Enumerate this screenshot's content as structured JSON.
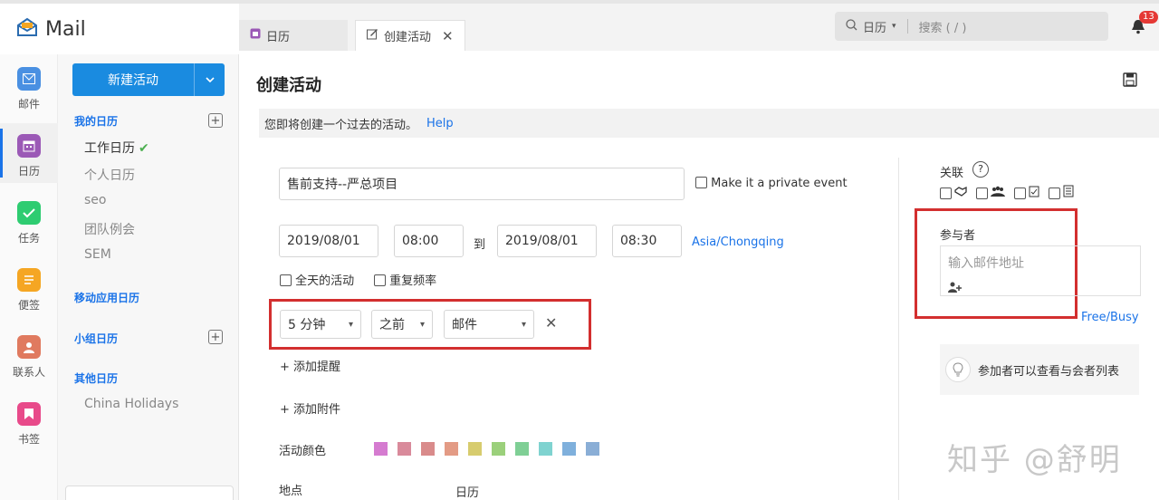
{
  "app": {
    "title": "Mail"
  },
  "rail": [
    {
      "label": "邮件",
      "icon": "mail-icon",
      "color": "#4a90e2"
    },
    {
      "label": "日历",
      "icon": "calendar-icon",
      "color": "#9b59b6"
    },
    {
      "label": "任务",
      "icon": "task-icon",
      "color": "#2ecc71"
    },
    {
      "label": "便签",
      "icon": "note-icon",
      "color": "#f5a623"
    },
    {
      "label": "联系人",
      "icon": "contacts-icon",
      "color": "#e07a5f"
    },
    {
      "label": "书签",
      "icon": "bookmark-icon",
      "color": "#e84a8a"
    }
  ],
  "sidebar": {
    "new_button": "新建活动",
    "my_calendars": "我的日历",
    "calendars": [
      "工作日历",
      "个人日历",
      "seo",
      "团队例会",
      "SEM"
    ],
    "mobile_calendars": "移动应用日历",
    "group_calendars": "小组日历",
    "other_calendars": "其他日历",
    "other_items": [
      "China Holidays"
    ]
  },
  "tabs": [
    {
      "label": "日历",
      "icon": "calendar-icon"
    },
    {
      "label": "创建活动",
      "icon": "edit-event-icon",
      "closable": true
    }
  ],
  "search": {
    "scope": "日历",
    "placeholder": "搜索 ( / )"
  },
  "notifications": {
    "count": "13"
  },
  "form": {
    "title": "创建活动",
    "notice": "您即将创建一个过去的活动。",
    "help": "Help",
    "event_title": "售前支持--严总项目",
    "private_label": "Make it a private event",
    "start_date": "2019/08/01",
    "start_time": "08:00",
    "to": "到",
    "end_date": "2019/08/01",
    "end_time": "08:30",
    "timezone": "Asia/Chongqing",
    "all_day": "全天的活动",
    "repeat": "重复频率",
    "reminder": {
      "amount": "5 分钟",
      "when": "之前",
      "type": "邮件"
    },
    "add_reminder": "添加提醒",
    "add_attachment": "添加附件",
    "color_label": "活动颜色",
    "colors": [
      "#d57bd0",
      "#d98a9b",
      "#d98b8b",
      "#e39b85",
      "#d7cc6e",
      "#9bd07b",
      "#7fcf95",
      "#7fd3d0",
      "#7fb0dc",
      "#8aaed6"
    ],
    "location_label": "地点",
    "calendar_label": "日历"
  },
  "right_panel": {
    "relation": "关联",
    "attendees": "参与者",
    "attendee_placeholder": "输入邮件地址",
    "free_busy": "Free/Busy",
    "permission": "参加者可以查看与会者列表"
  },
  "watermark": "知乎 @舒明"
}
